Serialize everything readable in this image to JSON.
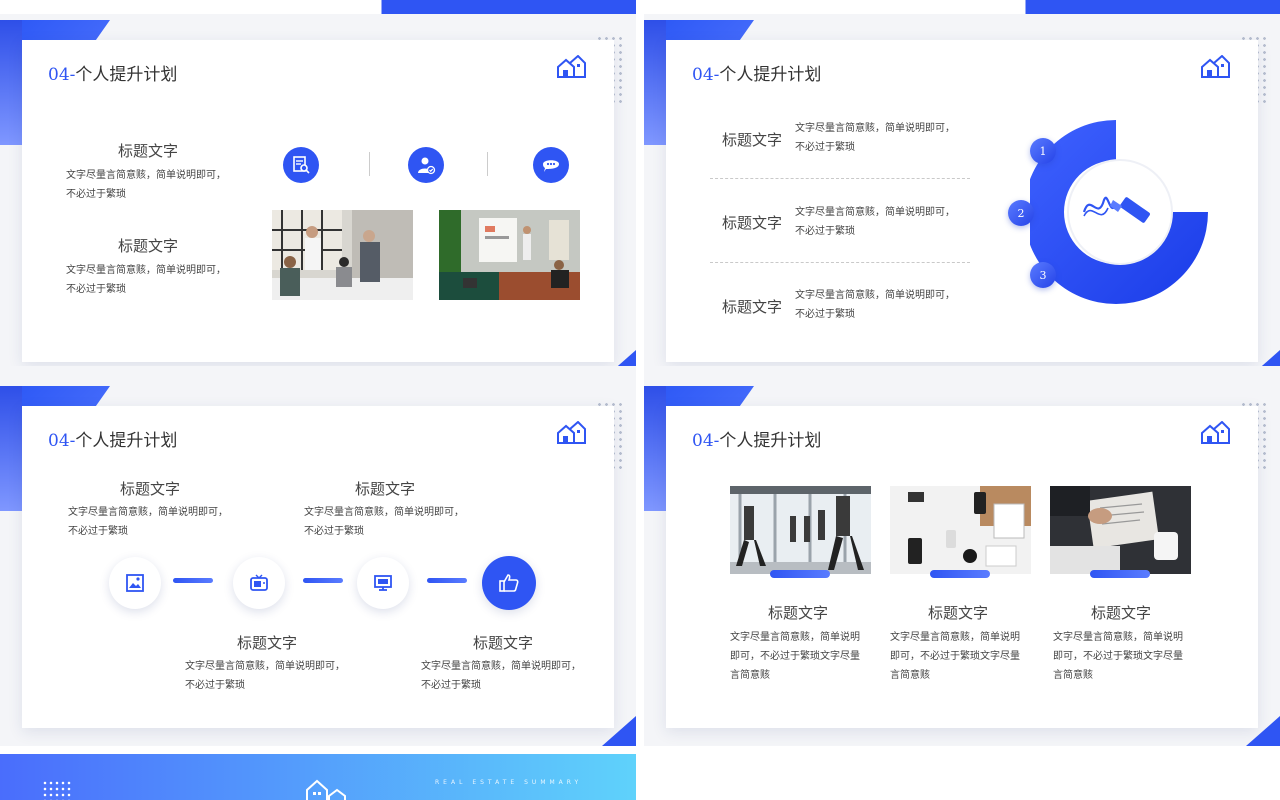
{
  "section_title": {
    "num": "04",
    "sep": "-",
    "text": "个人提升计划"
  },
  "heading": "标题文字",
  "body_2line": [
    "文字尽量言简意赅，简单说明即可，",
    "不必过于繁琐"
  ],
  "body_3line": [
    "文字尽量言简意赅，简单说明",
    "即可，不必过于繁琐文字尽量",
    "言简意赅"
  ],
  "badges": [
    "1",
    "2",
    "3"
  ],
  "banner_text": "REAL ESTATE SUMMARY",
  "colors": {
    "accent": "#2f55f3",
    "accent_light": "#5a7cff",
    "banner_end": "#5fd2fb"
  },
  "icons": {
    "slide1": [
      "document-search-icon",
      "user-check-icon",
      "chat-bubble-icon"
    ],
    "slide3": [
      "picture-icon",
      "tv-icon",
      "monitor-icon",
      "thumbs-up-icon"
    ],
    "slide2_center": "brush-icon",
    "logo": "house-logo-icon"
  }
}
